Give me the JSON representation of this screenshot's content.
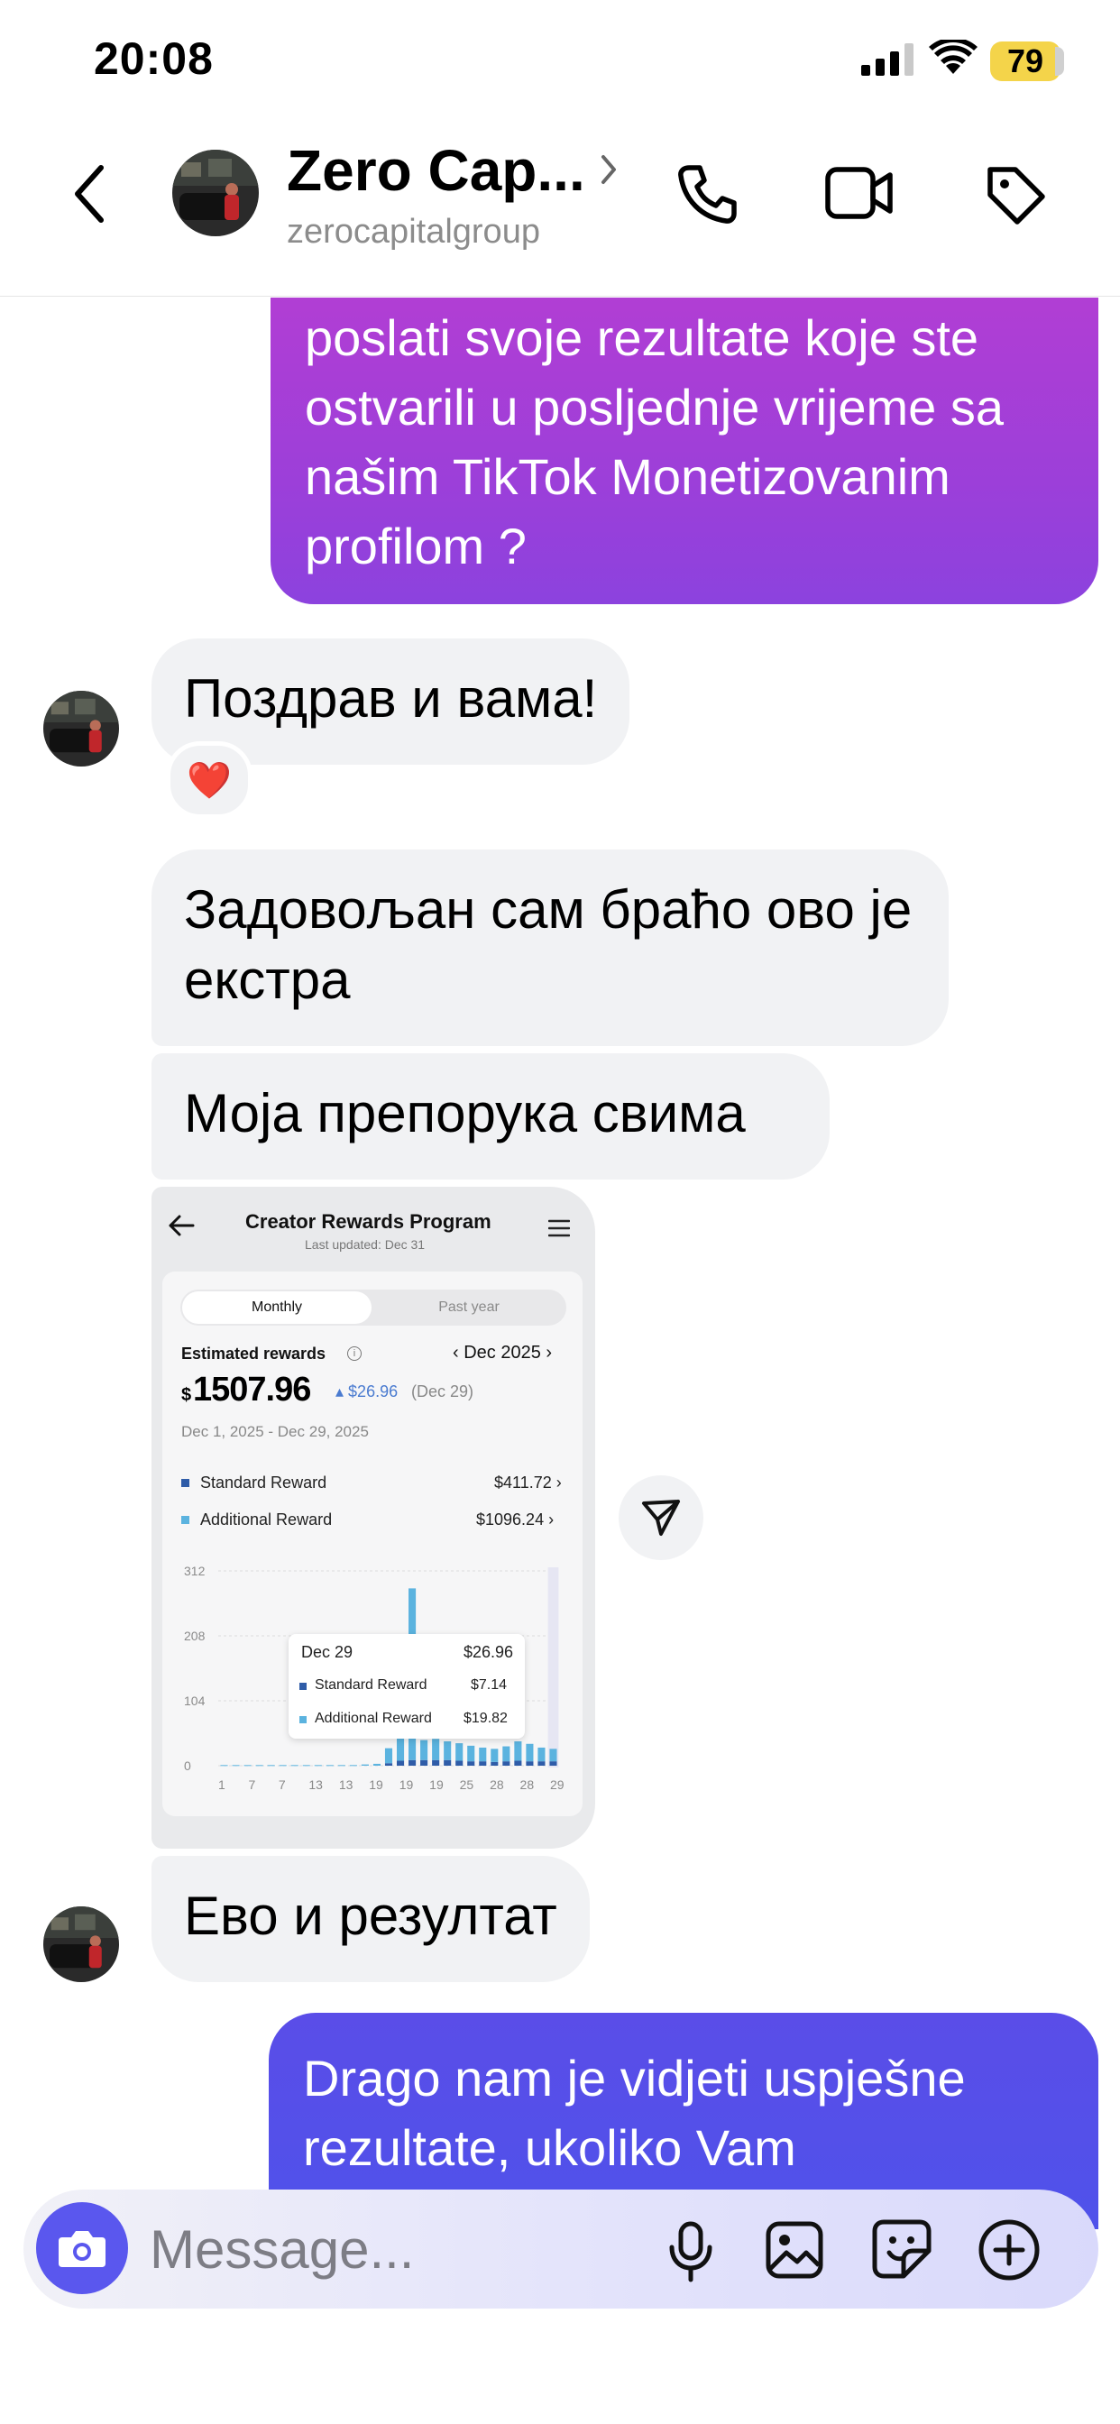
{
  "status_bar": {
    "time": "20:08",
    "battery": "79"
  },
  "header": {
    "contact_name": "Zero Cap...",
    "contact_handle": "zerocapitalgroup"
  },
  "messages": {
    "out_1": "poslati svoje rezultate koje ste ostvarili u posljednje vrijeme sa našim TikTok Monetizovanim profilom ?",
    "in_1": "Поздрав и вама!",
    "in_1_reaction": "❤️",
    "in_2": "Задовољан сам браћо ово је екстра",
    "in_3": "Моја препорука свима",
    "in_4": "Ево и резултат",
    "out_2": "Drago nam je vidjeti uspješne rezultate, ukoliko Vam"
  },
  "shared_image": {
    "title": "Creator Rewards Program",
    "last_updated": "Last updated: Dec 31",
    "tabs": [
      "Monthly",
      "Past year"
    ],
    "estimated_label": "Estimated rewards",
    "month_selector": "Dec 2025",
    "currency": "$",
    "total": "1507.96",
    "delta": "$26.96",
    "delta_date": "(Dec 29)",
    "date_range": "Dec 1, 2025 - Dec 29, 2025",
    "standard_label": "Standard Reward",
    "standard_value": "$411.72",
    "additional_label": "Additional Reward",
    "additional_value": "$1096.24",
    "tooltip": {
      "date": "Dec 29",
      "total": "$26.96",
      "standard_label": "Standard Reward",
      "standard_value": "$7.14",
      "additional_label": "Additional Reward",
      "additional_value": "$19.82"
    }
  },
  "chart_data": {
    "type": "bar",
    "stacked": true,
    "ylim": [
      0,
      312
    ],
    "y_ticks": [
      0,
      104,
      208,
      312
    ],
    "x_tick_labels": [
      "1",
      "7",
      "7",
      "13",
      "13",
      "19",
      "19",
      "19",
      "25",
      "28",
      "28",
      "29"
    ],
    "categories": [
      "1",
      "2",
      "3",
      "4",
      "5",
      "6",
      "7",
      "8",
      "9",
      "10",
      "11",
      "12",
      "13",
      "14",
      "15",
      "16",
      "17",
      "18",
      "19",
      "20",
      "21",
      "22",
      "23",
      "24",
      "25",
      "26",
      "27",
      "28",
      "29"
    ],
    "series": [
      {
        "name": "Standard Reward",
        "color": "#2f5ca8",
        "values": [
          0,
          0,
          0,
          0,
          0,
          0,
          0,
          0,
          0,
          0,
          0,
          0,
          0,
          0,
          4,
          8,
          9,
          9,
          9,
          9,
          8,
          7,
          7,
          6,
          7,
          8,
          7,
          7,
          7
        ]
      },
      {
        "name": "Additional Reward",
        "color": "#5bb3df",
        "values": [
          1,
          1,
          1,
          1,
          1,
          1,
          1,
          1,
          1,
          1,
          1,
          1,
          2,
          3,
          24,
          36,
          275,
          32,
          34,
          30,
          28,
          25,
          22,
          21,
          24,
          31,
          28,
          22,
          20
        ]
      }
    ],
    "grid": true
  },
  "composer": {
    "placeholder": "Message..."
  },
  "colors": {
    "accent": "#5a57ee",
    "outgoing_1": "#a03fd8",
    "outgoing_2": "#5350ea",
    "incoming": "#f1f2f4"
  }
}
